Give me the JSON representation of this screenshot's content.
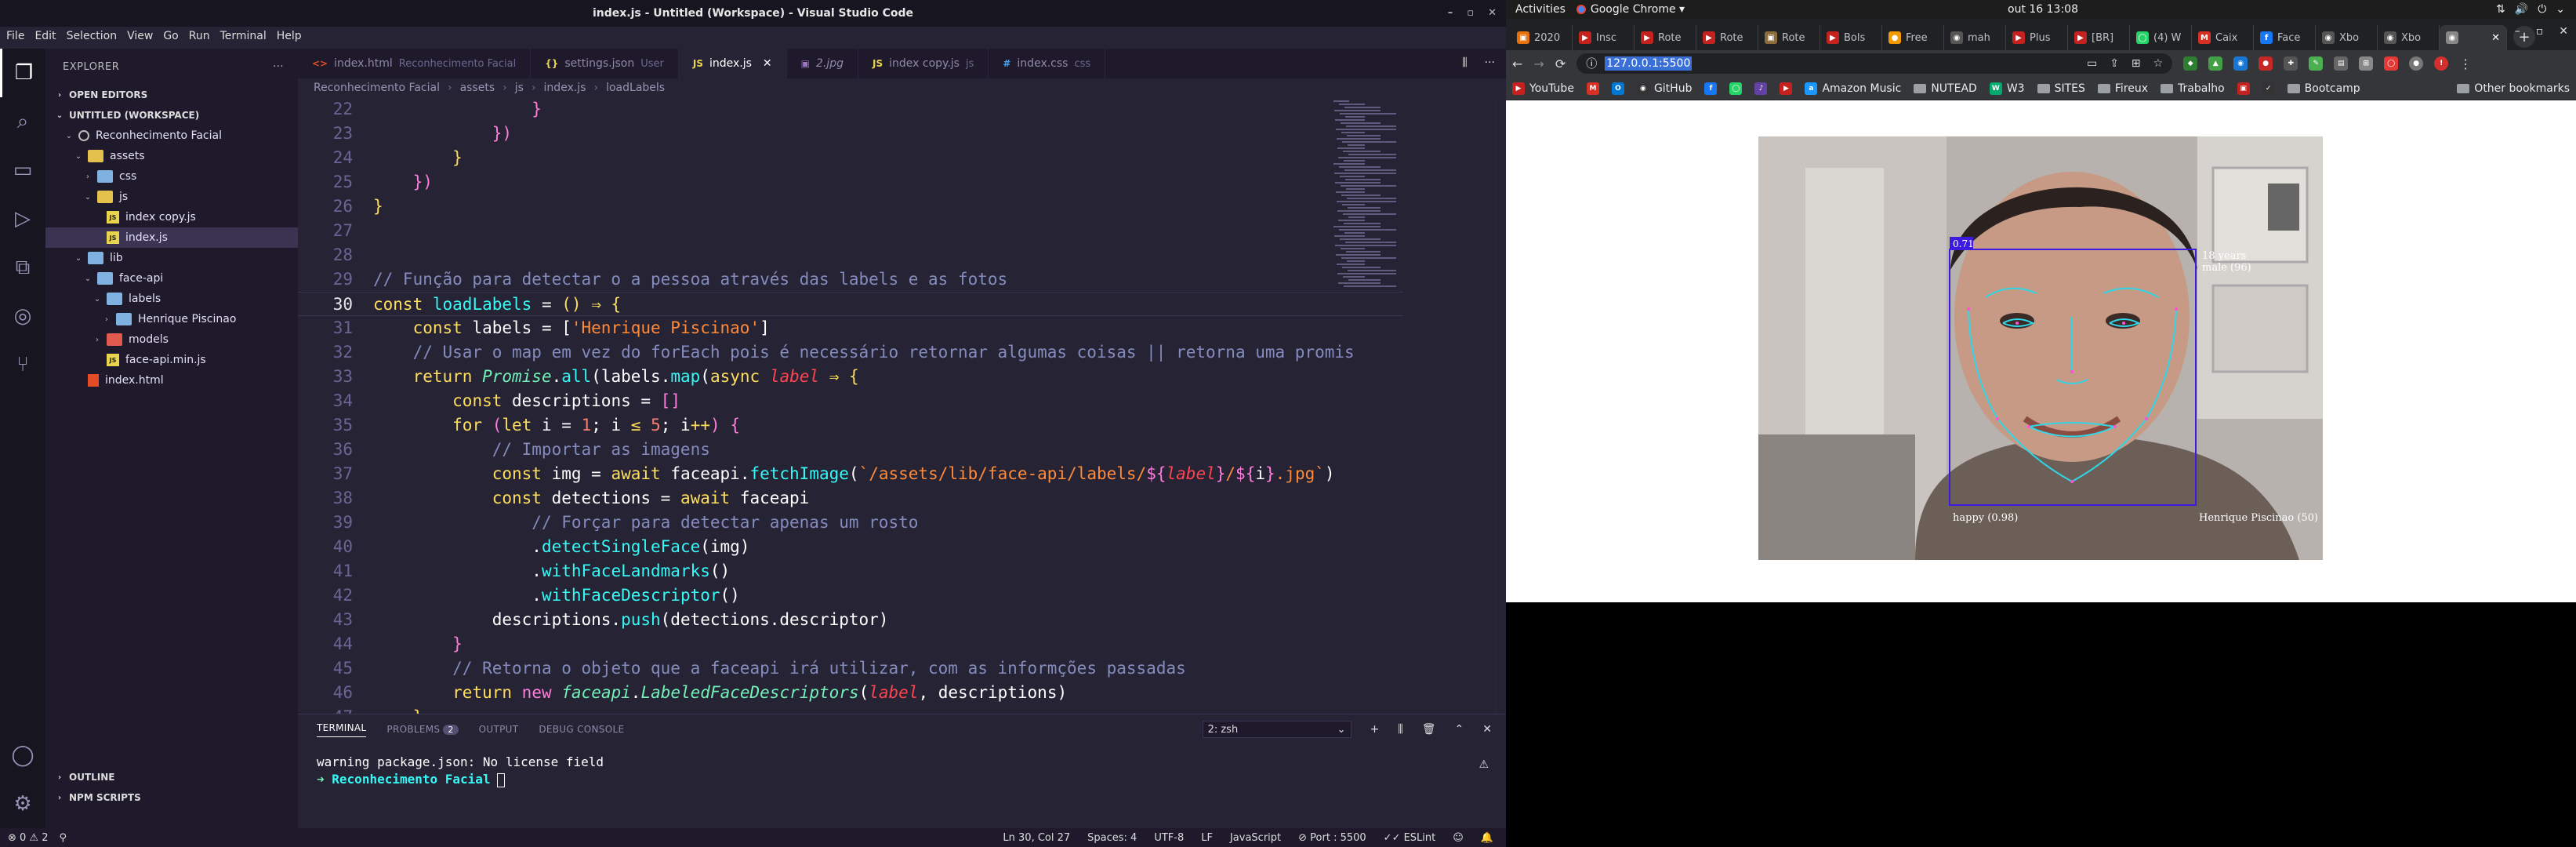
{
  "gnome": {
    "activities": "Activities",
    "app_name": "Google Chrome ▾",
    "clock": "out 16  13:08"
  },
  "vscode": {
    "window_title": "index.js - Untitled (Workspace) - Visual Studio Code",
    "menu": [
      "File",
      "Edit",
      "Selection",
      "View",
      "Go",
      "Run",
      "Terminal",
      "Help"
    ],
    "explorer": {
      "title": "EXPLORER",
      "open_editors": "OPEN EDITORS",
      "workspace": "UNTITLED (WORKSPACE)",
      "tree": [
        {
          "label": "Reconhecimento Facial",
          "depth": 1,
          "chev": "⌄",
          "kind": "ws"
        },
        {
          "label": "assets",
          "depth": 2,
          "chev": "⌄",
          "kind": "folder-yellow"
        },
        {
          "label": "css",
          "depth": 3,
          "chev": "›",
          "kind": "folder"
        },
        {
          "label": "js",
          "depth": 3,
          "chev": "⌄",
          "kind": "folder-yellow"
        },
        {
          "label": "index copy.js",
          "depth": 4,
          "chev": "",
          "kind": "js"
        },
        {
          "label": "index.js",
          "depth": 4,
          "chev": "",
          "kind": "js",
          "active": true
        },
        {
          "label": "lib",
          "depth": 2,
          "chev": "⌄",
          "kind": "folder"
        },
        {
          "label": "face-api",
          "depth": 3,
          "chev": "⌄",
          "kind": "folder"
        },
        {
          "label": "labels",
          "depth": 4,
          "chev": "⌄",
          "kind": "folder"
        },
        {
          "label": "Henrique Piscinao",
          "depth": 5,
          "chev": "›",
          "kind": "folder"
        },
        {
          "label": "models",
          "depth": 4,
          "chev": "›",
          "kind": "folder-red"
        },
        {
          "label": "face-api.min.js",
          "depth": 4,
          "chev": "",
          "kind": "js"
        },
        {
          "label": "index.html",
          "depth": 2,
          "chev": "",
          "kind": "html"
        }
      ],
      "outline": "OUTLINE",
      "npm_scripts": "NPM SCRIPTS"
    },
    "tabs": [
      {
        "label": "index.html",
        "desc": "Reconhecimento Facial",
        "icon": "<>",
        "icon_color": "#e34c26"
      },
      {
        "label": "settings.json",
        "desc": "User",
        "icon": "{}",
        "icon_color": "#e8d44d"
      },
      {
        "label": "index.js",
        "desc": "",
        "icon": "JS",
        "icon_color": "#e8d44d",
        "active": true
      },
      {
        "label": "2.jpg",
        "desc": "",
        "icon": "▣",
        "icon_color": "#a074c4"
      },
      {
        "label": "index copy.js",
        "desc": "js",
        "icon": "JS",
        "icon_color": "#e8d44d"
      },
      {
        "label": "index.css",
        "desc": "css",
        "icon": "#",
        "icon_color": "#42a5f5"
      }
    ],
    "breadcrumb": [
      "Reconhecimento Facial",
      "assets",
      "js",
      "index.js",
      "loadLabels"
    ],
    "code_lines": [
      {
        "n": "22",
        "html": "                <span class='brk'>}</span>"
      },
      {
        "n": "23",
        "html": "            <span class='brk'>})</span>"
      },
      {
        "n": "24",
        "html": "        <span class='kw'>}</span>"
      },
      {
        "n": "25",
        "html": "    <span class='pk'>})</span>"
      },
      {
        "n": "26",
        "html": "<span class='kw'>}</span>"
      },
      {
        "n": "27",
        "html": ""
      },
      {
        "n": "28",
        "html": ""
      },
      {
        "n": "29",
        "html": "<span class='com'>// Função para detectar o a pessoa através das labels e as fotos</span>"
      },
      {
        "n": "30",
        "html": "<span class='kw'>const</span> <span class='fn'>loadLabels</span> = <span class='kw'>()</span> <span class='kw'>⇒</span> <span class='kw'>{</span>",
        "current": true
      },
      {
        "n": "31",
        "html": "    <span class='kw'>const</span> labels = [<span class='str'>'Henrique Piscinao'</span>]"
      },
      {
        "n": "32",
        "html": "    <span class='com'>// Usar o map em vez do forEach pois é necessário retornar algumas coisas || retorna uma promis</span>"
      },
      {
        "n": "33",
        "html": "    <span class='kw'>return</span> <span class='it'>Promise</span>.<span class='fn'>all</span>(labels.<span class='fn'>map</span>(<span class='kw'>async</span> <span class='ital'>label</span> <span class='kw'>⇒</span> <span class='kw'>{</span>"
      },
      {
        "n": "34",
        "html": "        <span class='kw'>const</span> descriptions = <span class='pk'>[]</span>"
      },
      {
        "n": "35",
        "html": "        <span class='kw'>for</span> <span class='pk'>(</span><span class='kw'>let</span> i = <span class='num2'>1</span>; i <span class='kw'>≤</span> <span class='num2'>5</span>; i<span class='kw'>++</span><span class='pk'>)</span> <span class='pk'>{</span>"
      },
      {
        "n": "36",
        "html": "            <span class='com'>// Importar as imagens</span>"
      },
      {
        "n": "37",
        "html": "            <span class='kw'>const</span> img = <span class='kw'>await</span> faceapi.<span class='fn'>fetchImage</span>(<span class='str'>`/assets/lib/face-api/labels/</span><span class='pk'>${</span><span class='ital'>label</span><span class='pk'>}</span><span class='str'>/</span><span class='pk'>${</span>i<span class='pk'>}</span><span class='str'>.jpg`</span>)"
      },
      {
        "n": "38",
        "html": "            <span class='kw'>const</span> detections = <span class='kw'>await</span> faceapi"
      },
      {
        "n": "39",
        "html": "                <span class='com'>// Forçar para detectar apenas um rosto</span>"
      },
      {
        "n": "40",
        "html": "                .<span class='fn'>detectSingleFace</span>(img)"
      },
      {
        "n": "41",
        "html": "                .<span class='fn'>withFaceLandmarks</span>()"
      },
      {
        "n": "42",
        "html": "                .<span class='fn'>withFaceDescriptor</span>()"
      },
      {
        "n": "43",
        "html": "            descriptions.<span class='fn'>push</span>(detections.descriptor)"
      },
      {
        "n": "44",
        "html": "        <span class='pk'>}</span>"
      },
      {
        "n": "45",
        "html": "        <span class='com'>// Retorna o objeto que a faceapi irá utilizar, com as informções passadas</span>"
      },
      {
        "n": "46",
        "html": "        <span class='kw'>return</span> <span class='pk'>new</span> <span class='it'>faceapi</span>.<span class='it'>LabeledFaceDescriptors</span>(<span class='ital'>label</span>, descriptions)"
      },
      {
        "n": "47",
        "html": "    <span class='kw'>}</span>"
      }
    ],
    "panel": {
      "tabs": [
        "TERMINAL",
        "PROBLEMS",
        "OUTPUT",
        "DEBUG CONSOLE"
      ],
      "problems_count": "2",
      "terminal_select": "2: zsh",
      "line1": "warning package.json: No license field",
      "prompt_arrow": "➜",
      "prompt_cwd": "Reconhecimento Facial"
    },
    "status": {
      "errors": "⊗ 0 ⚠ 2",
      "position": "Ln 30, Col 27",
      "spaces": "Spaces: 4",
      "encoding": "UTF-8",
      "eol": "LF",
      "language": "JavaScript",
      "port": "⊘ Port : 5500",
      "eslint": "✓✓ ESLint"
    }
  },
  "chrome": {
    "tabs": [
      {
        "label": "2020",
        "color": "#e8710a",
        "icon": "▣"
      },
      {
        "label": "Insc",
        "color": "#c5221f",
        "icon": "▶"
      },
      {
        "label": "Rote",
        "color": "#c5221f",
        "icon": "▶"
      },
      {
        "label": "Rote",
        "color": "#c5221f",
        "icon": "▶"
      },
      {
        "label": "Rote",
        "color": "#8a6d3b",
        "icon": "▣"
      },
      {
        "label": "Bols",
        "color": "#c5221f",
        "icon": "▶"
      },
      {
        "label": "Free",
        "color": "#f29900",
        "icon": "●"
      },
      {
        "label": "mah",
        "color": "#555",
        "icon": "◉"
      },
      {
        "label": "Plus",
        "color": "#c5221f",
        "icon": "▶"
      },
      {
        "label": "[BR]",
        "color": "#c5221f",
        "icon": "▶"
      },
      {
        "label": "(4) W",
        "color": "#25d366",
        "icon": "◯"
      },
      {
        "label": "Caix",
        "color": "#d93025",
        "icon": "M"
      },
      {
        "label": "Face",
        "color": "#1877f2",
        "icon": "f"
      },
      {
        "label": "Xbo",
        "color": "#555",
        "icon": "◉"
      },
      {
        "label": "Xbo",
        "color": "#555",
        "icon": "◉"
      },
      {
        "label": "",
        "color": "#888",
        "icon": "◉",
        "active": true
      }
    ],
    "url": "127.0.0.1:5500",
    "bookmarks": [
      {
        "label": "YouTube",
        "color": "#c5221f",
        "icon": "▶"
      },
      {
        "label": "",
        "color": "#d93025",
        "icon": "M"
      },
      {
        "label": "",
        "color": "#0078d4",
        "icon": "O"
      },
      {
        "label": "GitHub",
        "color": "#333",
        "icon": "◉"
      },
      {
        "label": "",
        "color": "#1877f2",
        "icon": "f"
      },
      {
        "label": "",
        "color": "#25d366",
        "icon": "◯"
      },
      {
        "label": "",
        "color": "#6441a5",
        "icon": "♪"
      },
      {
        "label": "",
        "color": "#c5221f",
        "icon": "▶"
      },
      {
        "label": "Amazon Music",
        "color": "#1a98ff",
        "icon": "a"
      },
      {
        "label": "NUTEAD",
        "color": "",
        "icon": "folder"
      },
      {
        "label": "W3",
        "color": "#04aa6d",
        "icon": "W"
      },
      {
        "label": "SITES",
        "color": "",
        "icon": "folder"
      },
      {
        "label": "Fireux",
        "color": "",
        "icon": "folder"
      },
      {
        "label": "Trabalho",
        "color": "",
        "icon": "folder"
      },
      {
        "label": "",
        "color": "#c5221f",
        "icon": "▣"
      },
      {
        "label": "",
        "color": "#333",
        "icon": "✓"
      },
      {
        "label": "Bootcamp",
        "color": "",
        "icon": "folder"
      }
    ],
    "other_bookmarks": "Other bookmarks",
    "detection": {
      "score": "0.71",
      "age_gender_1": "18 years",
      "age_gender_2": "male (96)",
      "expression": "happy (0.98)",
      "match": "Henrique Piscinao (50)"
    }
  }
}
